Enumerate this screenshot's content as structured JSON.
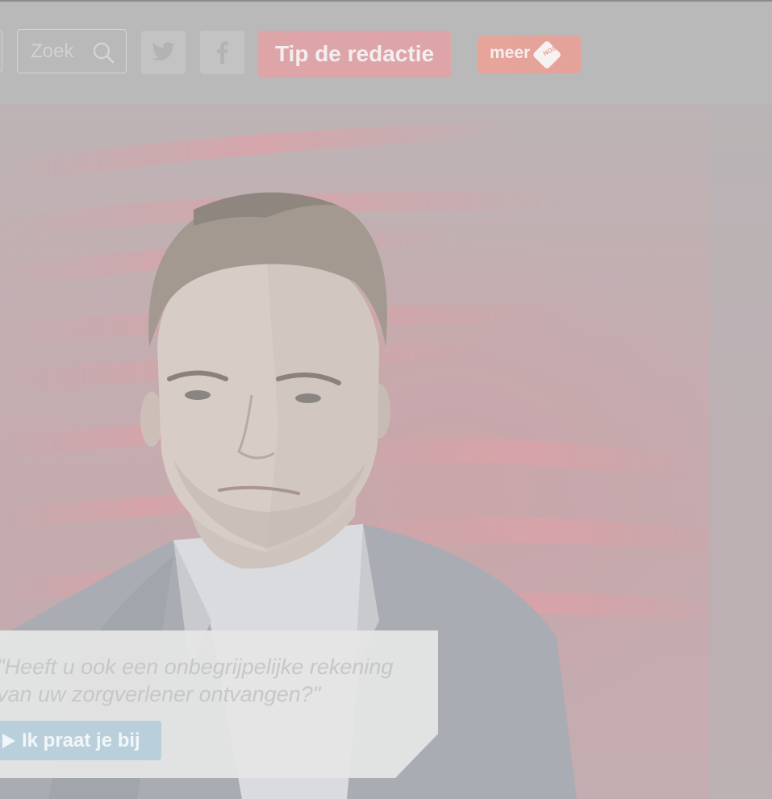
{
  "header": {
    "search": {
      "placeholder": "Zoek",
      "icon": "search-icon"
    },
    "social": [
      {
        "name": "twitter",
        "icon": "twitter-icon"
      },
      {
        "name": "facebook",
        "icon": "facebook-icon"
      }
    ],
    "tip_button_label": "Tip de redactie",
    "meer_button": {
      "label": "meer",
      "logo_text": "NOS",
      "icon": "npo-logo-icon"
    }
  },
  "hero": {
    "quote": "\"Heeft u ook een onbegrijpelijke rekening van uw zorgverlener ontvangen?\"",
    "cta_label": "Ik praat je bij",
    "cta_icon": "play-icon"
  },
  "colors": {
    "overlay": "#b9b9b9",
    "tip_button": "#dea5a8",
    "meer_button": "#e6a49a",
    "cta_button": "#b9d0dc",
    "hero_red": "#c7a3a8"
  }
}
